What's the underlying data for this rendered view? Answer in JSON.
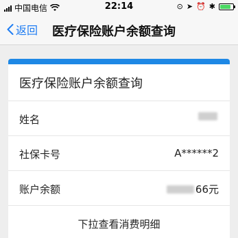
{
  "status_bar": {
    "carrier": "中国电信",
    "time": "22:14",
    "icons": [
      "signal-icon",
      "wifi-icon",
      "rotation-lock-icon",
      "location-icon",
      "alarm-icon",
      "bluetooth-icon",
      "battery-icon"
    ],
    "battery_level": 0.85
  },
  "nav": {
    "back_label": "返回",
    "title": "医疗保险账户余额查询"
  },
  "card": {
    "title": "医疗保险账户余额查询",
    "rows": [
      {
        "label": "姓名",
        "value": ""
      },
      {
        "label": "社保卡号",
        "value": "A******2"
      },
      {
        "label": "账户余额",
        "value": "66元"
      }
    ],
    "footer": "下拉查看消费明细"
  },
  "colors": {
    "accent": "#1e7cf2",
    "band": "#1e88e5",
    "background": "#eeeeee"
  }
}
